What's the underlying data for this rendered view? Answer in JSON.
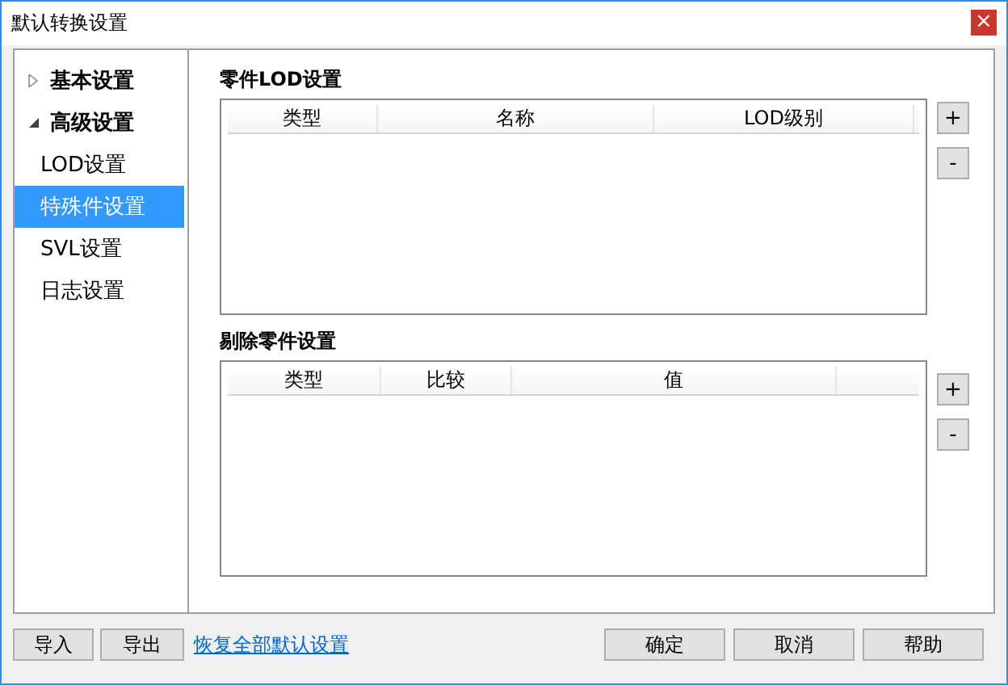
{
  "window": {
    "title": "默认转换设置",
    "close": "×"
  },
  "sidebar": {
    "items": [
      {
        "label": "基本设置",
        "expanded": false,
        "selected": false
      },
      {
        "label": "高级设置",
        "expanded": true,
        "selected": false,
        "children": [
          {
            "label": "LOD设置",
            "selected": false
          },
          {
            "label": "特殊件设置",
            "selected": true
          },
          {
            "label": "SVL设置",
            "selected": false
          },
          {
            "label": "日志设置",
            "selected": false
          }
        ]
      }
    ]
  },
  "sections": [
    {
      "title": "零件LOD设置",
      "columns": [
        "类型",
        "名称",
        "LOD级别"
      ],
      "buttons": [
        "+",
        "-"
      ]
    },
    {
      "title": "剔除零件设置",
      "columns": [
        "类型",
        "比较",
        "值"
      ],
      "buttons": [
        "+",
        "-"
      ]
    }
  ],
  "footer": {
    "left_buttons": [
      "导入",
      "导出"
    ],
    "link": "恢复全部默认设置",
    "right_buttons": [
      "确定",
      "取消",
      "帮助"
    ]
  }
}
